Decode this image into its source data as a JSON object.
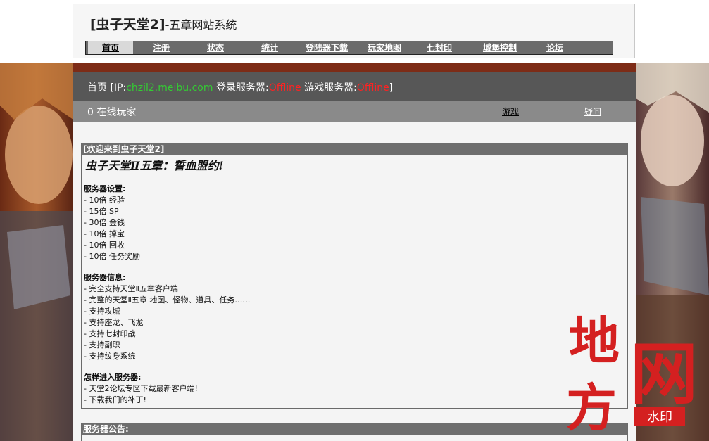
{
  "header": {
    "title_bold": "[虫子天堂2]",
    "title_rest": "-五章网站系统"
  },
  "nav": {
    "items": [
      {
        "label": "首页",
        "active": true
      },
      {
        "label": "注册"
      },
      {
        "label": "状态"
      },
      {
        "label": "统计"
      },
      {
        "label": "登陆器下载"
      },
      {
        "label": "玩家地图"
      },
      {
        "label": "七封印"
      },
      {
        "label": "城堡控制"
      },
      {
        "label": "论坛"
      }
    ]
  },
  "status": {
    "home": "首页",
    "ip_prefix": "[IP:",
    "ip": "chzil2.meibu.com",
    "login_label": "登录服务器:",
    "login_status": "Offline",
    "game_label": "游戏服务器:",
    "game_status": "Offline",
    "suffix": "]"
  },
  "online": {
    "count_text": "0 在线玩家",
    "games_link": "游戏",
    "faq_link": "疑问"
  },
  "welcome": {
    "header": "[欢迎来到虫子天堂2]",
    "slogan": "虫子天堂Ⅱ五章：誓血盟约!",
    "settings_title": "服务器设置:",
    "settings": [
      "- 10倍 经验",
      "- 15倍 SP",
      "- 30倍 金钱",
      "- 10倍 掉宝",
      "- 10倍 回收",
      "- 10倍 任务奖励"
    ],
    "info_title": "服务器信息:",
    "info": [
      "- 完全支持天堂Ⅱ五章客户端",
      "- 完整的天堂Ⅱ五章 地图、怪物、道具、任务……",
      "- 支持攻城",
      "- 支持座龙、飞龙",
      "- 支持七封印战",
      "- 支持副职",
      "- 支持纹身系统"
    ],
    "join_title": "怎样进入服务器:",
    "join": [
      "- 天堂2论坛专区下载最新客户端!",
      "- 下载我们的补丁!"
    ]
  },
  "notice": {
    "header": "服务器公告:"
  },
  "watermark": {
    "text_main": "地方网",
    "text_stamp": "水印",
    "color": "#d42020"
  }
}
